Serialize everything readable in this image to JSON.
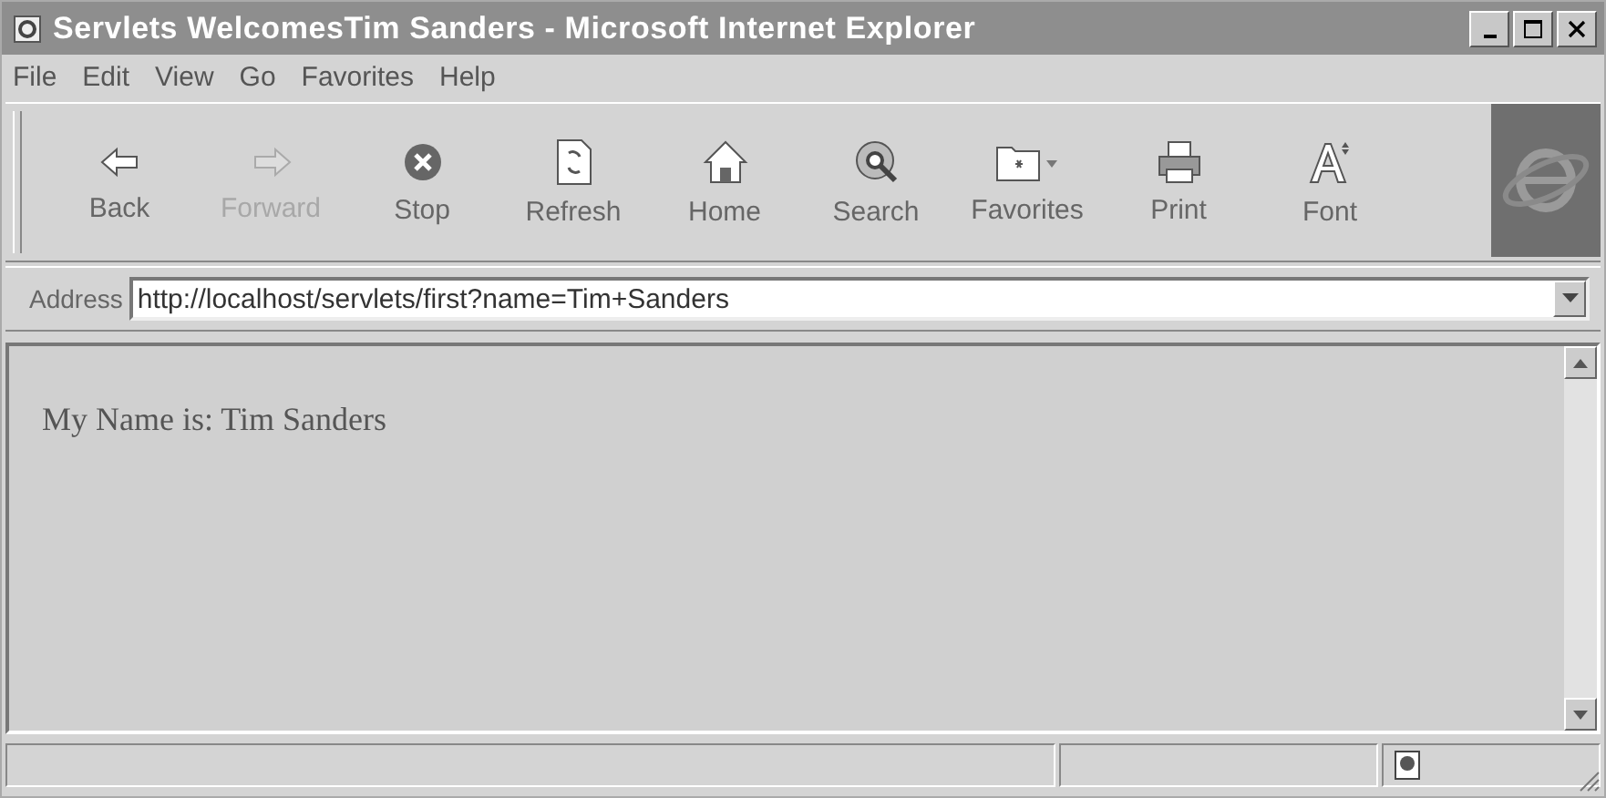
{
  "window": {
    "title": "Servlets WelcomesTim Sanders - Microsoft Internet Explorer"
  },
  "menu": [
    "File",
    "Edit",
    "View",
    "Go",
    "Favorites",
    "Help"
  ],
  "toolbar": [
    {
      "kind": "back",
      "label": "Back",
      "disabled": false
    },
    {
      "kind": "forward",
      "label": "Forward",
      "disabled": true
    },
    {
      "kind": "stop",
      "label": "Stop",
      "disabled": false
    },
    {
      "kind": "refresh",
      "label": "Refresh",
      "disabled": false
    },
    {
      "kind": "home",
      "label": "Home",
      "disabled": false
    },
    {
      "kind": "search",
      "label": "Search",
      "disabled": false
    },
    {
      "kind": "favorites",
      "label": "Favorites",
      "disabled": false
    },
    {
      "kind": "print",
      "label": "Print",
      "disabled": false
    },
    {
      "kind": "font",
      "label": "Font",
      "disabled": false
    }
  ],
  "address": {
    "label": "Address",
    "value": "http://localhost/servlets/first?name=Tim+Sanders"
  },
  "page": {
    "text": "My Name is: Tim Sanders"
  }
}
